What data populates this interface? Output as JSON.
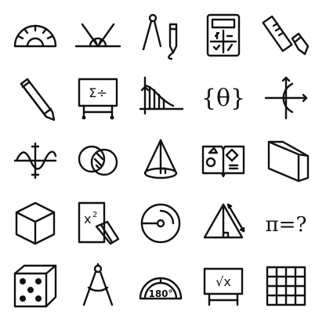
{
  "colors": {
    "stroke": "#111111",
    "background": "#ffffff"
  },
  "icons": [
    {
      "name": "protractor-icon"
    },
    {
      "name": "angles-icon"
    },
    {
      "name": "compass-pencil-icon"
    },
    {
      "name": "calculator-icon"
    },
    {
      "name": "ruler-pencil-icon"
    },
    {
      "name": "pencil-icon"
    },
    {
      "name": "summation-board-icon",
      "text": "Σ÷"
    },
    {
      "name": "area-under-curve-icon"
    },
    {
      "name": "theta-set-icon",
      "text": "{θ}"
    },
    {
      "name": "polar-graph-icon"
    },
    {
      "name": "sine-wave-icon"
    },
    {
      "name": "venn-diagram-icon"
    },
    {
      "name": "cone-icon"
    },
    {
      "name": "geometry-book-icon"
    },
    {
      "name": "prism-icon"
    },
    {
      "name": "cube-icon"
    },
    {
      "name": "x-squared-document-icon",
      "text": "x",
      "sup": "2"
    },
    {
      "name": "circle-radius-icon"
    },
    {
      "name": "triangle-measure-icon"
    },
    {
      "name": "pi-question-icon",
      "text": "π=?"
    },
    {
      "name": "dice-icon"
    },
    {
      "name": "divider-compass-icon"
    },
    {
      "name": "protractor-180-icon",
      "text": "180°"
    },
    {
      "name": "square-root-board-icon",
      "text": "√x"
    },
    {
      "name": "grid-table-icon"
    }
  ]
}
